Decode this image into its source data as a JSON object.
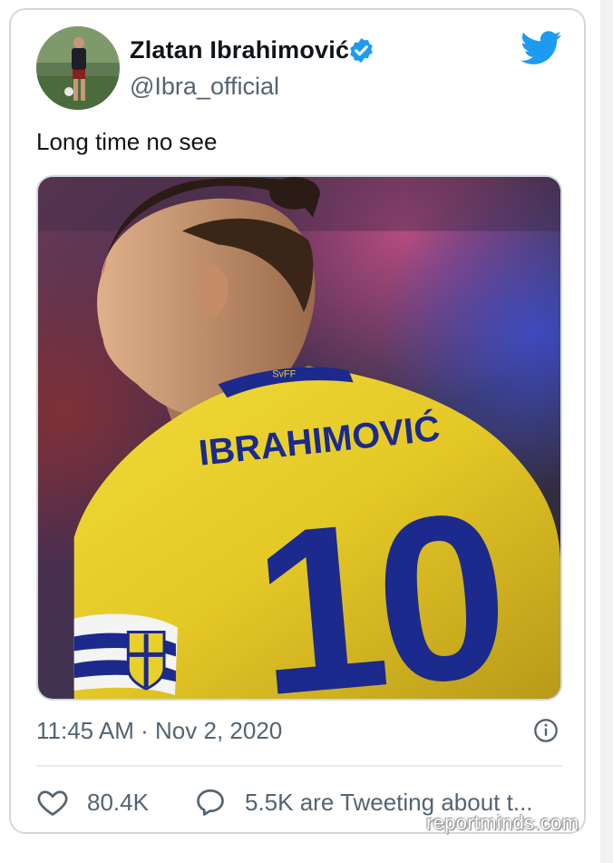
{
  "tweet": {
    "author": {
      "display_name": "Zlatan Ibrahimović",
      "handle": "@Ibra_official",
      "verified": true
    },
    "text": "Long time no see",
    "media": {
      "jersey_name": "IBRAHIMOVIĆ",
      "jersey_number": "10",
      "collar_text": "SvFF"
    },
    "timestamp": "11:45 AM · Nov 2, 2020",
    "actions": {
      "likes": "80.4K",
      "tweeting_about": "5.5K are Tweeting about t..."
    }
  },
  "watermark": "reportminds.com",
  "icons": {
    "verified": "verified-badge-icon",
    "brand": "twitter-bird-icon",
    "info": "info-icon",
    "like": "heart-icon",
    "reply": "speech-bubble-icon"
  },
  "colors": {
    "brand_blue": "#1d9bf0",
    "text_primary": "#0f1419",
    "text_secondary": "#536471",
    "border": "#cfd9de",
    "jersey_yellow": "#e8cf2a",
    "jersey_blue": "#1b2a8c"
  }
}
